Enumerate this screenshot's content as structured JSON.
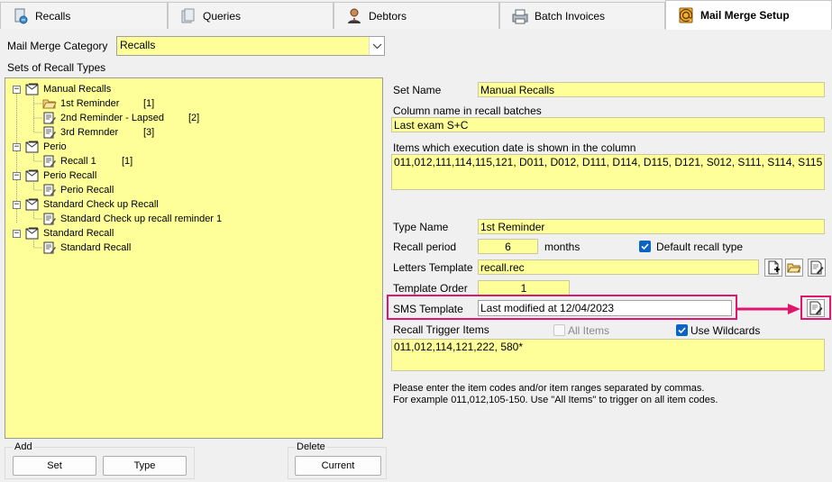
{
  "tabs": [
    {
      "label": "Recalls",
      "icon": "recalls-icon"
    },
    {
      "label": "Queries",
      "icon": "queries-icon"
    },
    {
      "label": "Debtors",
      "icon": "debtors-icon"
    },
    {
      "label": "Batch Invoices",
      "icon": "batch-invoices-icon"
    },
    {
      "label": "Mail Merge Setup",
      "icon": "mail-merge-icon",
      "active": true
    }
  ],
  "category": {
    "label": "Mail Merge Category",
    "value": "Recalls"
  },
  "sets_label": "Sets of Recall Types",
  "tree": [
    {
      "label": "Manual Recalls",
      "children": [
        {
          "label": "1st Reminder",
          "order": "[1]"
        },
        {
          "label": "2nd Reminder - Lapsed",
          "order": "[2]"
        },
        {
          "label": "3rd Remnder",
          "order": "[3]"
        }
      ]
    },
    {
      "label": "Perio",
      "children": [
        {
          "label": "Recall 1",
          "order": "[1]"
        }
      ]
    },
    {
      "label": "Perio Recall",
      "children": [
        {
          "label": "Perio Recall",
          "order": ""
        }
      ]
    },
    {
      "label": "Standard Check up Recall",
      "children": [
        {
          "label": "Standard Check up recall reminder 1",
          "order": ""
        }
      ]
    },
    {
      "label": "Standard Recall",
      "children": [
        {
          "label": "Standard Recall",
          "order": ""
        }
      ]
    }
  ],
  "add_group": {
    "title": "Add",
    "set_label": "Set",
    "type_label": "Type"
  },
  "delete_group": {
    "title": "Delete",
    "current_label": "Current"
  },
  "set_name": {
    "label": "Set Name",
    "value": "Manual Recalls"
  },
  "column_name": {
    "label": "Column name in recall batches",
    "value": "Last exam S+C"
  },
  "items_exec": {
    "label": "Items which execution date is shown in the column",
    "value": "011,012,111,114,115,121, D011, D012, D111, D114, D115, D121, S012, S111, S114, S115"
  },
  "type_name": {
    "label": "Type Name",
    "value": "1st Reminder"
  },
  "recall_period": {
    "label": "Recall period",
    "value": "6",
    "unit": "months"
  },
  "default_recall": {
    "label": "Default recall type",
    "checked": true
  },
  "letters_template": {
    "label": "Letters Template",
    "value": "recall.rec"
  },
  "template_order": {
    "label": "Template Order",
    "value": "1"
  },
  "sms_template": {
    "label": "SMS Template",
    "value": "Last modified at 12/04/2023"
  },
  "trigger": {
    "label": "Recall Trigger Items",
    "all_items_label": "All Items",
    "all_items_checked": false,
    "wildcards_label": "Use Wildcards",
    "wildcards_checked": true,
    "value": "011,012,114,121,222, 580*"
  },
  "help": {
    "line1": "Please enter the item codes and/or item ranges separated by commas.",
    "line2": "For example 011,012,105-150. Use \"All Items\" to trigger on all item codes."
  },
  "highlight_color": "#e0156e"
}
